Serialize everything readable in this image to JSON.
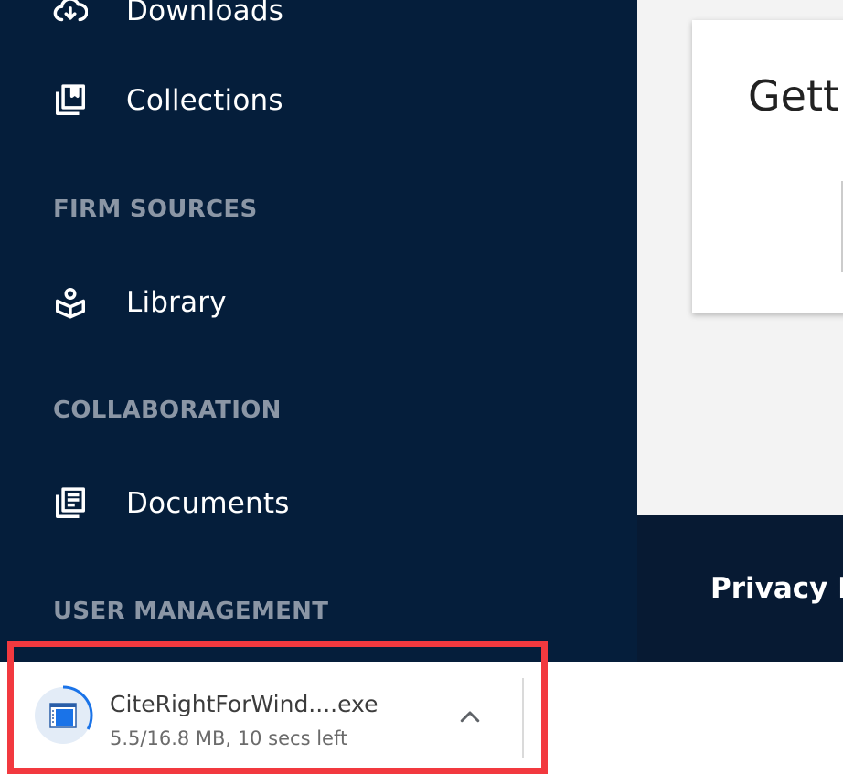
{
  "sidebar": {
    "items": [
      {
        "label": "Downloads",
        "icon": "cloud-download-icon"
      },
      {
        "label": "Collections",
        "icon": "collections-bookmark-icon"
      },
      {
        "label": "Library",
        "icon": "library-reader-icon"
      },
      {
        "label": "Documents",
        "icon": "documents-icon"
      }
    ],
    "sections": {
      "firm_sources": "FIRM SOURCES",
      "collaboration": "COLLABORATION",
      "user_management": "USER MANAGEMENT"
    }
  },
  "main": {
    "card_title": "Getti"
  },
  "footer": {
    "link": "Privacy P"
  },
  "download": {
    "filename": "CiteRightForWind....exe",
    "status": "5.5/16.8 MB, 10 secs left",
    "progress_fraction": 0.33,
    "icon": "exe-file-icon",
    "chevron_icon": "chevron-up-icon"
  },
  "colors": {
    "sidebar_bg": "#051e3b",
    "highlight_border": "#f2393f",
    "progress_ring": "#1a73e8"
  }
}
